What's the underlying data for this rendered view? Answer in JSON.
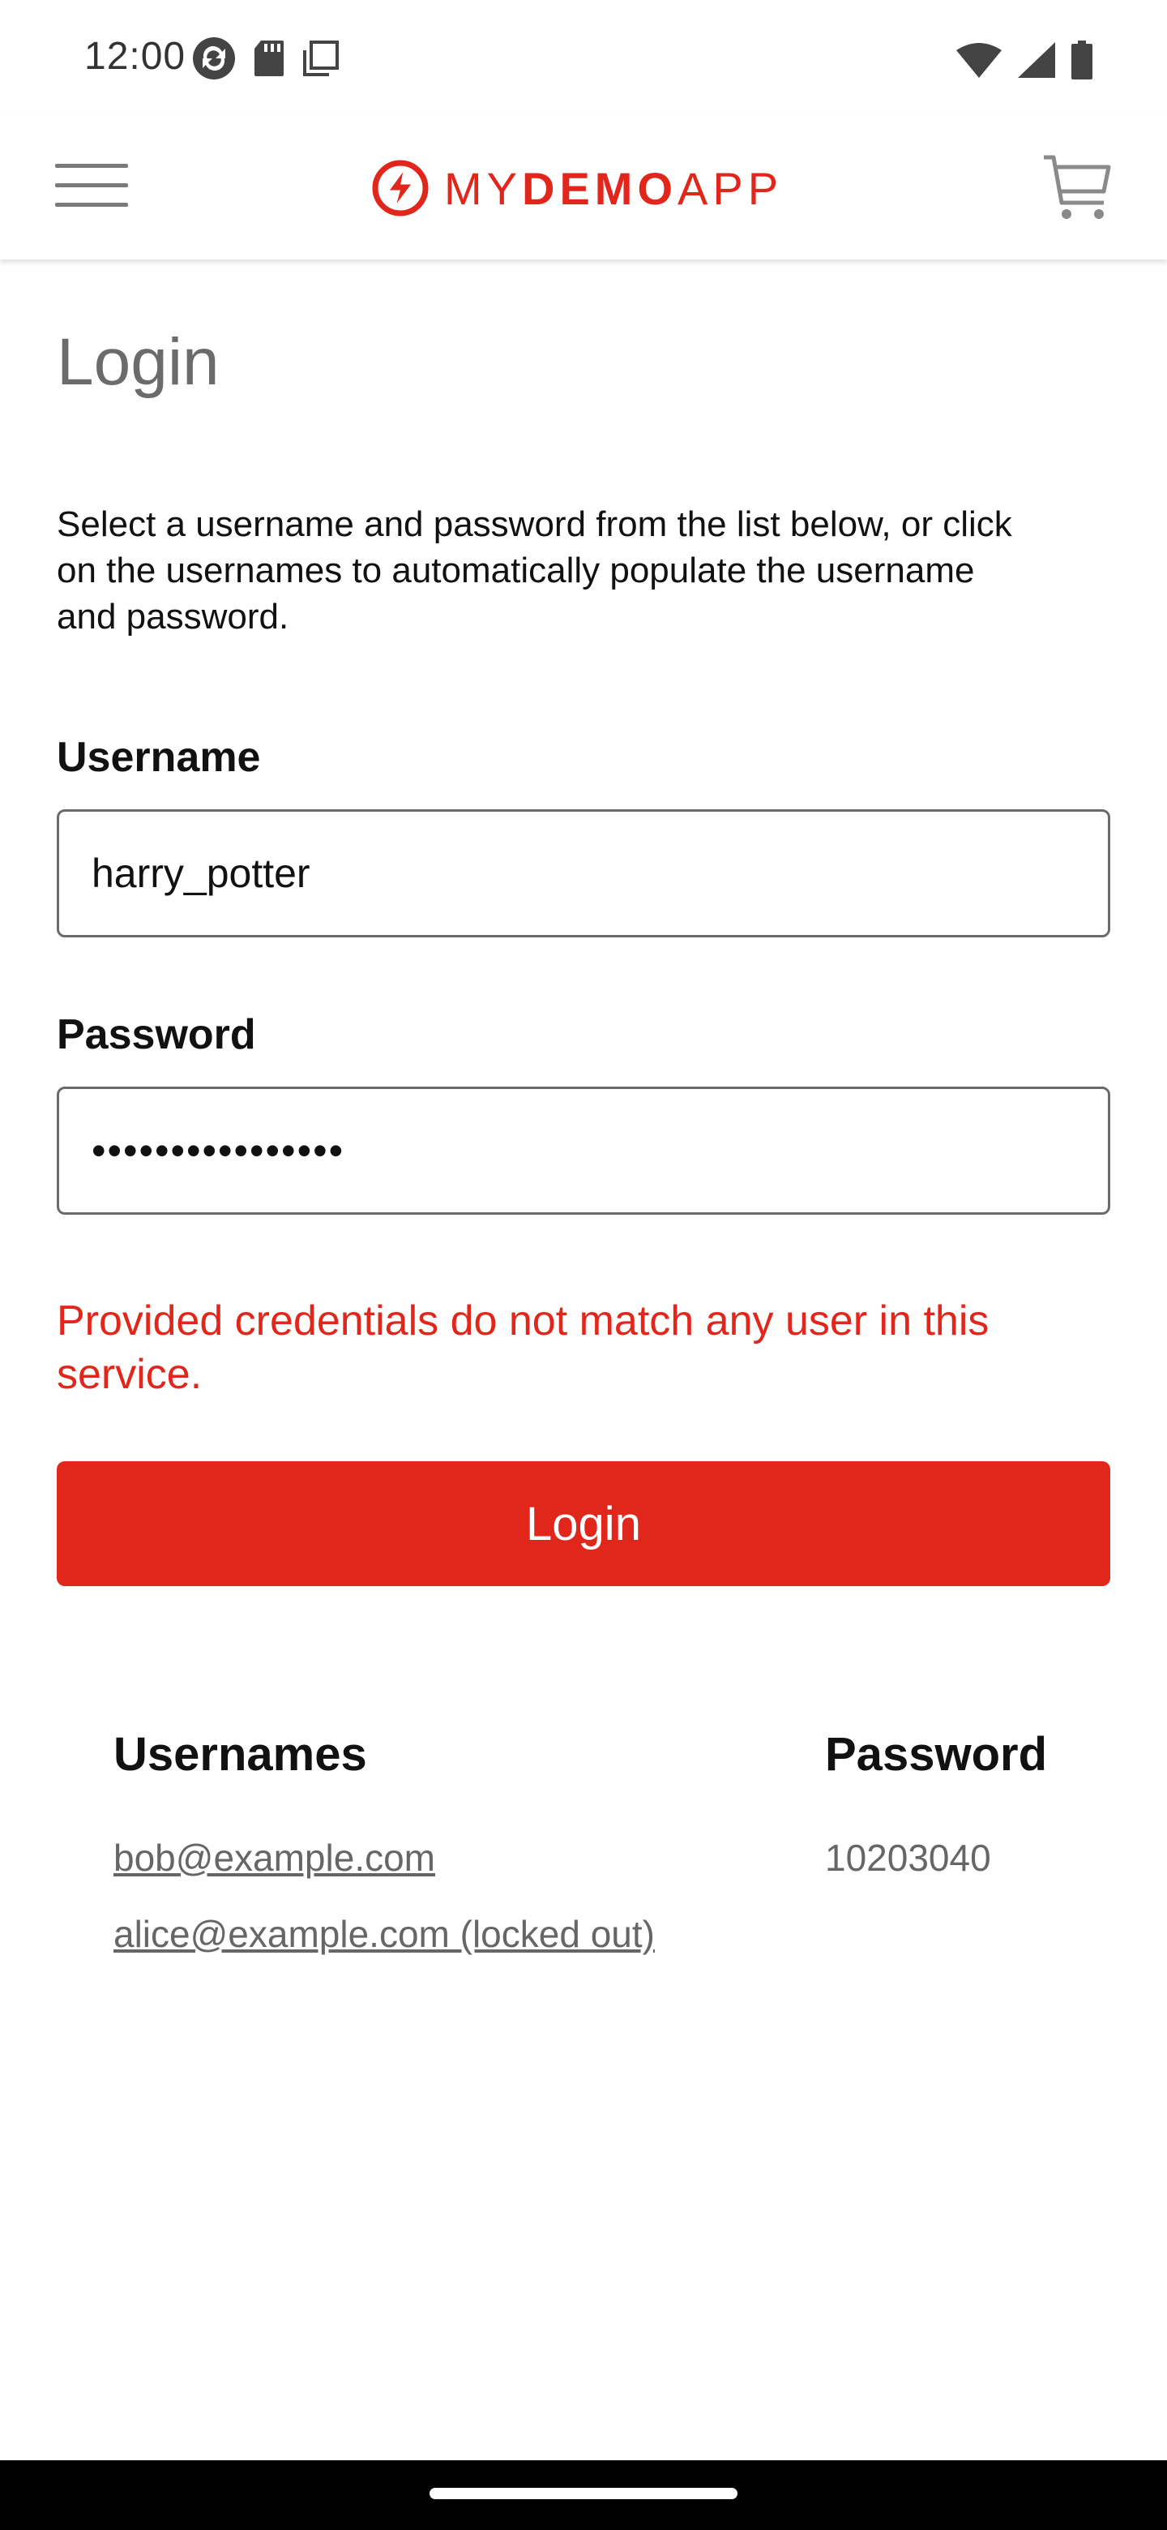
{
  "status_bar": {
    "time": "12:00"
  },
  "header": {
    "logo_light_1": "MY",
    "logo_bold": "DEMO",
    "logo_light_2": "APP",
    "brand_color": "#e1261c"
  },
  "page": {
    "title": "Login",
    "intro": "Select a username and password from the list below, or click on the usernames to automatically populate the username and password."
  },
  "form": {
    "username_label": "Username",
    "username_value": "harry_potter",
    "password_label": "Password",
    "password_value": "••••••••••••••••",
    "error_message": "Provided credentials do not match any user in this service.",
    "login_button_label": "Login"
  },
  "credentials": {
    "usernames_header": "Usernames",
    "password_header": "Password",
    "users": [
      {
        "username": "bob@example.com"
      },
      {
        "username": "alice@example.com (locked out)"
      }
    ],
    "password": "10203040"
  },
  "icons": {
    "menu": "hamburger-menu-icon",
    "cart": "cart-icon",
    "logo": "lightning-bolt-logo-icon"
  }
}
